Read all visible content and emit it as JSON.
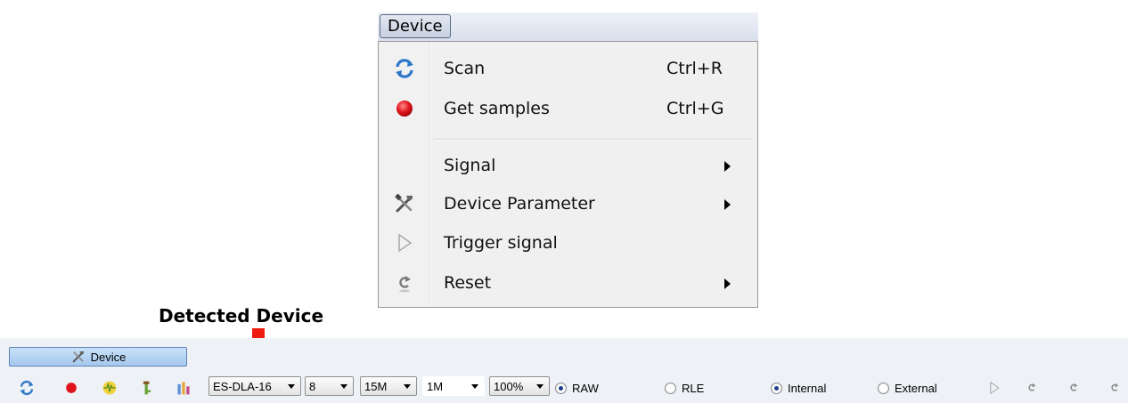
{
  "menu": {
    "title": "Device",
    "items": [
      {
        "label": "Scan",
        "shortcut": "Ctrl+R",
        "icon": "refresh-icon"
      },
      {
        "label": "Get samples",
        "shortcut": "Ctrl+G",
        "icon": "record-icon"
      },
      {
        "label": "Signal",
        "icon": "",
        "submenu": true
      },
      {
        "label": "Device Parameter",
        "icon": "tools-icon",
        "submenu": true
      },
      {
        "label": "Trigger signal",
        "icon": "play-icon"
      },
      {
        "label": "Reset",
        "icon": "reset-icon",
        "submenu": true
      }
    ]
  },
  "annotation": {
    "label": "Detected Device",
    "color": "#ee1c0e"
  },
  "toolbar": {
    "tab_label": "Device",
    "icons": [
      "refresh-icon",
      "record-icon",
      "signal-icon",
      "tools-icon",
      "chart-icon"
    ],
    "device_select": "ES-DLA-16",
    "channels_select": "8",
    "rate_select": "15M",
    "depth_select": "1M",
    "zoom_select": "100%",
    "mode_raw": "RAW",
    "mode_rle": "RLE",
    "mode_selected": "RAW",
    "clock_internal": "Internal",
    "clock_external": "External",
    "clock_selected": "Internal",
    "trailing_icons": [
      "play-icon",
      "reset-icon",
      "reset-icon",
      "reset-icon"
    ]
  },
  "colors": {
    "toolbar_bg": "#eef1f6",
    "tab_bg": "#b7d5f3",
    "record_red": "#e0141c",
    "refresh_blue": "#2d78c8"
  }
}
